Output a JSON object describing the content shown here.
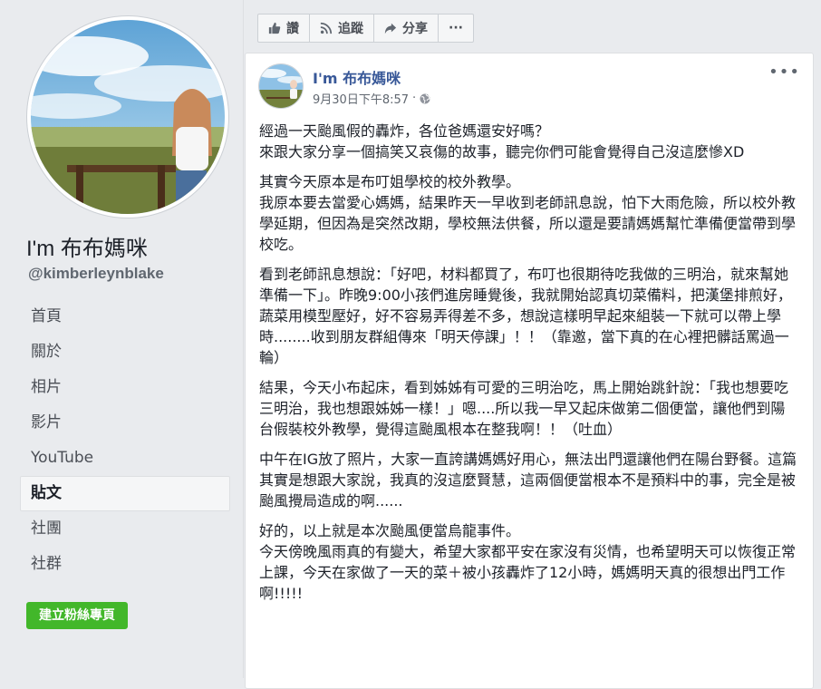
{
  "page": {
    "name": "I'm 布布媽咪",
    "handle": "@kimberleynblake"
  },
  "nav": {
    "items": [
      "首頁",
      "關於",
      "相片",
      "影片",
      "YouTube",
      "貼文",
      "社團",
      "社群"
    ],
    "active": "貼文"
  },
  "create_page_button": "建立粉絲專頁",
  "action_bar": {
    "like": "讚",
    "follow": "追蹤",
    "share": "分享",
    "more": "···"
  },
  "post": {
    "author": "I'm 布布媽咪",
    "timestamp": "9月30日下午8:57",
    "privacy_icon": "globe-icon",
    "paragraphs": [
      "經過一天颱風假的轟炸，各位爸媽還安好嗎？\n來跟大家分享一個搞笑又哀傷的故事，聽完你們可能會覺得自己沒這麼慘XD",
      "其實今天原本是布叮姐學校的校外教學。\n我原本要去當愛心媽媽，結果昨天一早收到老師訊息說，怕下大雨危險，所以校外教學延期，但因為是突然改期，學校無法供餐，所以還是要請媽媽幫忙準備便當帶到學校吃。",
      "看到老師訊息想說：「好吧，材料都買了，布叮也很期待吃我做的三明治，就來幫她準備一下」。昨晚9:00小孩們進房睡覺後，我就開始認真切菜備料，把漢堡排煎好，蔬菜用模型壓好，好不容易弄得差不多，想說這樣明早起來組裝一下就可以帶上學時........收到朋友群組傳來「明天停課」！！（靠邀，當下真的在心裡把髒話罵過一輪）",
      "結果，今天小布起床，看到姊姊有可愛的三明治吃，馬上開始跳針說：「我也想要吃三明治，我也想跟姊姊一樣！」嗯....所以我一早又起床做第二個便當，讓他們到陽台假裝校外教學，覺得這颱風根本在整我啊！！（吐血）",
      "中午在IG放了照片，大家一直誇講媽媽好用心，無法出門還讓他們在陽台野餐。這篇其實是想跟大家說，我真的沒這麼賢慧，這兩個便當根本不是預料中的事，完全是被颱風攪局造成的啊......",
      "好的，以上就是本次颱風便當烏龍事件。\n今天傍晚風雨真的有變大，希望大家都平安在家沒有災情，也希望明天可以恢復正常上課，今天在家做了一天的菜＋被小孩轟炸了12小時，媽媽明天真的很想出門工作啊!!!!!"
    ]
  }
}
